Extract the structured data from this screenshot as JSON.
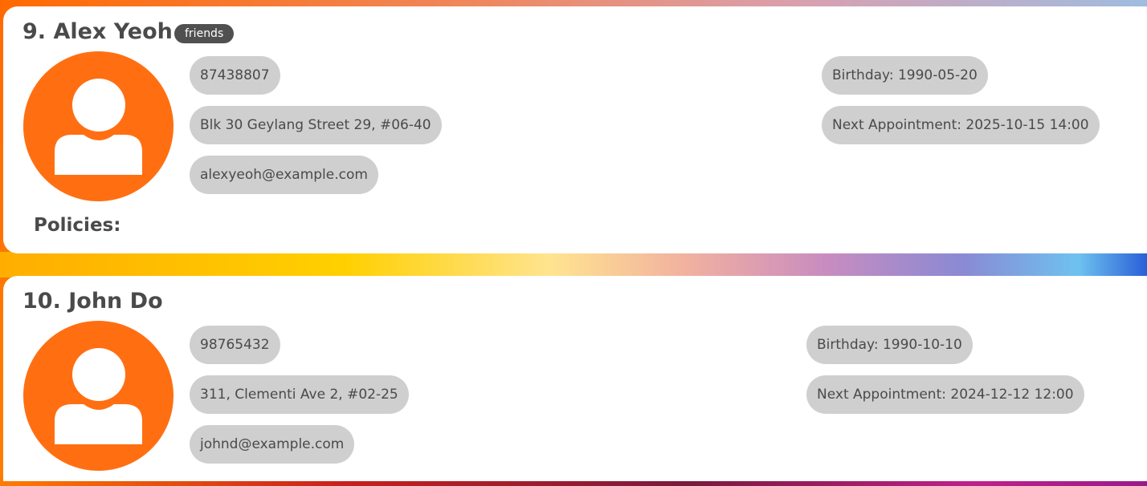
{
  "persons": [
    {
      "index_name": "9. Alex Yeoh",
      "tags": [
        "friends"
      ],
      "phone": "87438807",
      "address": "Blk 30 Geylang Street 29, #06-40",
      "email": "alexyeoh@example.com",
      "birthday": "Birthday: 1990-05-20",
      "appointment": "Next Appointment: 2025-10-15 14:00",
      "policies_label": "Policies:"
    },
    {
      "index_name": "10. John Do",
      "tags": [],
      "phone": "98765432",
      "address": "311, Clementi Ave 2, #02-25",
      "email": "johnd@example.com",
      "birthday": "Birthday: 1990-10-10",
      "appointment": "Next Appointment: 2024-12-12 12:00"
    }
  ],
  "colors": {
    "avatar_bg": "#ff6f12",
    "pill_bg": "#cfcfcf",
    "tag_bg": "#505050",
    "text": "#4a4a4a",
    "card_bg": "#ffffff"
  },
  "icons": {
    "avatar": "person-silhouette-icon"
  }
}
